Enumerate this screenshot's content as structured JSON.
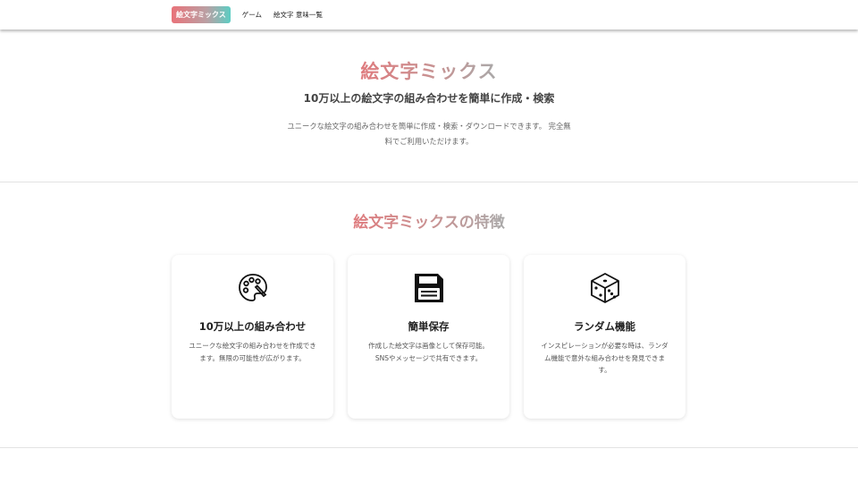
{
  "nav": {
    "brand": "絵文字ミックス",
    "links": [
      "ゲーム",
      "絵文字 意味一覧"
    ]
  },
  "hero": {
    "title": "絵文字ミックス",
    "subtitle": "10万以上の絵文字の組み合わせを簡単に作成・検索",
    "description": "ユニークな絵文字の組み合わせを簡単に作成・検索・ダウンロードできます。 完全無料でご利用いただけます。"
  },
  "features": {
    "title": "絵文字ミックスの特徴",
    "cards": [
      {
        "icon": "palette-icon",
        "title": "10万以上の組み合わせ",
        "description": "ユニークな絵文字の組み合わせを作成できます。無限の可能性が広がります。"
      },
      {
        "icon": "floppy-disk-icon",
        "title": "簡単保存",
        "description": "作成した絵文字は画像として保存可能。SNSやメッセージで共有できます。"
      },
      {
        "icon": "dice-icon",
        "title": "ランダム機能",
        "description": "インスピレーションが必要な時は、ランダム機能で意外な組み合わせを発見できます。"
      }
    ]
  },
  "colors": {
    "brand_gradient_start": "#e9737a",
    "brand_gradient_end": "#5ccdc3",
    "title_gradient_start": "#df7b7e",
    "title_gradient_end": "#a9a9a9"
  }
}
